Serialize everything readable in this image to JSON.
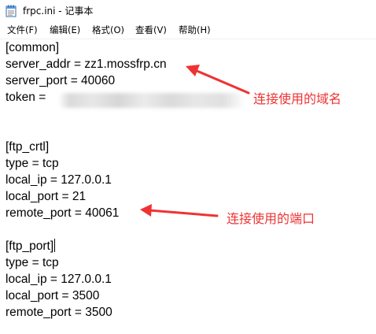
{
  "window": {
    "title": "frpc.ini - 记事本",
    "app_icon": "notepad-icon"
  },
  "menu": {
    "items": [
      "文件(F)",
      "编辑(E)",
      "格式(O)",
      "查看(V)",
      "帮助(H)"
    ]
  },
  "editor": {
    "lines": [
      "[common]",
      "server_addr = zz1.mossfrp.cn",
      "server_port = 40060",
      "token = ",
      "",
      "",
      "[ftp_crtl]",
      "type = tcp",
      "local_ip = 127.0.0.1",
      "local_port = 21",
      "remote_port = 40061",
      "",
      "[ftp_port]",
      "type = tcp",
      "local_ip = 127.0.0.1",
      "local_port = 3500",
      "remote_port = 3500"
    ]
  },
  "annotations": {
    "domain_note": "连接使用的域名",
    "port_note": "连接使用的端口",
    "color": "#ee3333"
  }
}
